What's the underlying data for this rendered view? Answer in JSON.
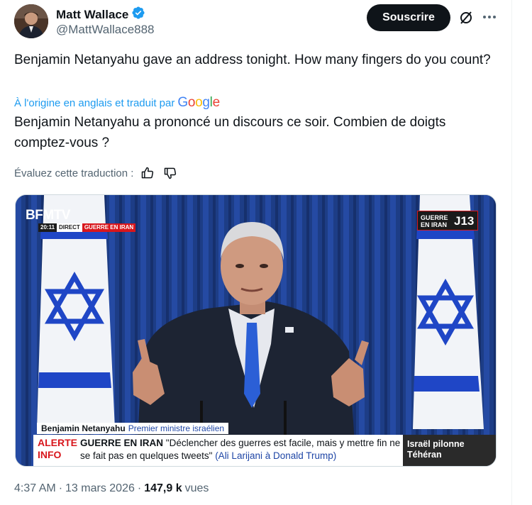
{
  "author": {
    "display_name": "Matt Wallace",
    "handle": "@MattWallace888",
    "verified": true,
    "verified_color": "#1d9bf0"
  },
  "header": {
    "subscribe_label": "Souscrire",
    "grok_icon": "grok-slash-icon",
    "more_icon": "more-horizontal-icon"
  },
  "post": {
    "original_text": "Benjamin Netanyahu gave an address tonight. How many fingers do you count?",
    "translated_by_prefix": "À l'origine en anglais et traduit par",
    "translator_logo": "Google",
    "translated_text": "Benjamin Netanyahu a prononcé un discours ce soir. Combien de doigts comptez-vous ?",
    "rate_label": "Évaluez cette traduction :",
    "rate_icons": [
      "thumbs-up-icon",
      "thumbs-down-icon"
    ]
  },
  "media": {
    "channel_logo": "BFMTV",
    "time": "20:11",
    "live_label": "DIRECT",
    "topic_tag": "GUERRE EN IRAN",
    "corner_tag": "GUERRE EN IRAN",
    "day_counter": "J13",
    "speaker_name": "Benjamin Netanyahu",
    "speaker_role": "Premier ministre israélien",
    "alert_line1": "ALERTE",
    "alert_line2": "INFO",
    "headline_topic": "GUERRE EN IRAN",
    "headline_quote": "\"Déclencher des guerres est facile, mais y mettre fin ne se fait pas en quelques tweets\"",
    "headline_source": "(Ali Larijani à Donald Trump)",
    "ticker_text": "Israël pilonne Téhéran",
    "colors": {
      "alert_red": "#d8161c",
      "flag_blue": "#1f46c6",
      "backdrop_blue": "#1a3b7c"
    }
  },
  "footer": {
    "time": "4:37 AM",
    "date": "13 mars 2026",
    "views_count": "147,9 k",
    "views_label": "vues"
  }
}
